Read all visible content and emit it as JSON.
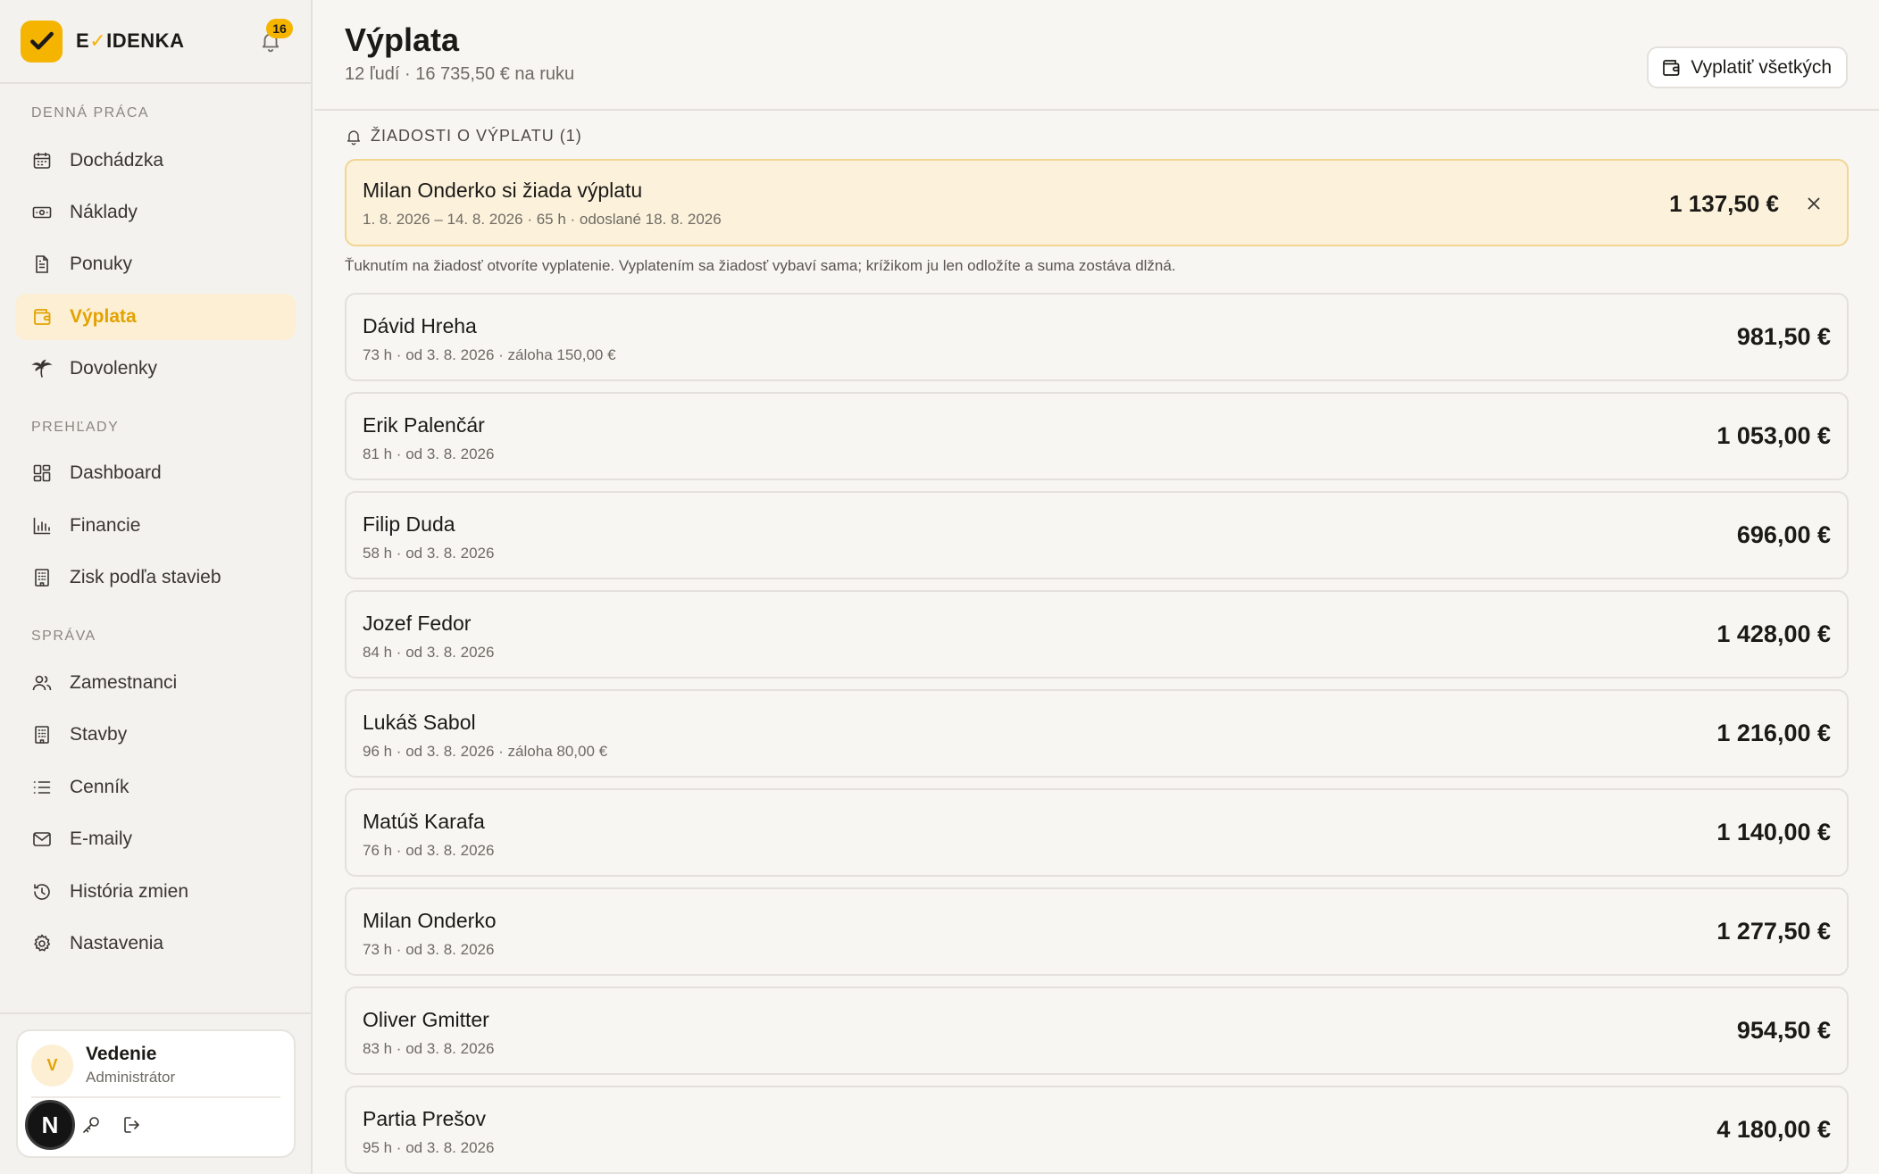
{
  "brand": {
    "name_prefix": "E",
    "name_mark": "✓",
    "name_suffix": "IDENKA",
    "notification_count": "16"
  },
  "sidebar": {
    "sections": [
      {
        "title": "DENNÁ PRÁCA",
        "items": [
          {
            "label": "Dochádzka",
            "icon": "calendar-icon"
          },
          {
            "label": "Náklady",
            "icon": "cash-icon"
          },
          {
            "label": "Ponuky",
            "icon": "document-icon"
          },
          {
            "label": "Výplata",
            "icon": "wallet-icon",
            "active": true
          },
          {
            "label": "Dovolenky",
            "icon": "palm-tree-icon"
          }
        ]
      },
      {
        "title": "PREHĽADY",
        "items": [
          {
            "label": "Dashboard",
            "icon": "dashboard-icon"
          },
          {
            "label": "Financie",
            "icon": "bar-chart-icon"
          },
          {
            "label": "Zisk podľa stavieb",
            "icon": "building-icon"
          }
        ]
      },
      {
        "title": "SPRÁVA",
        "items": [
          {
            "label": "Zamestnanci",
            "icon": "users-icon"
          },
          {
            "label": "Stavby",
            "icon": "building-icon"
          },
          {
            "label": "Cenník",
            "icon": "list-icon"
          },
          {
            "label": "E-maily",
            "icon": "mail-icon"
          },
          {
            "label": "História zmien",
            "icon": "history-icon"
          },
          {
            "label": "Nastavenia",
            "icon": "gear-icon"
          }
        ]
      }
    ],
    "user": {
      "initial": "V",
      "name": "Vedenie",
      "role": "Administrátor",
      "badge": "N"
    }
  },
  "header": {
    "title": "Výplata",
    "subtitle": "12 ľudí · 16 735,50 € na ruku",
    "pay_all_label": "Vyplatiť všetkých"
  },
  "requests": {
    "title": "ŽIADOSTI O VÝPLATU (1)",
    "items": [
      {
        "title": "Milan Onderko si žiada výplatu",
        "meta": "1. 8. 2026 – 14. 8. 2026 · 65 h · odoslané 18. 8. 2026",
        "amount": "1 137,50 €"
      }
    ],
    "hint": "Ťuknutím na žiadosť otvoríte vyplatenie. Vyplatením sa žiadosť vybaví sama; krížikom ju len odložíte a suma zostáva dlžná."
  },
  "employees": [
    {
      "name": "Dávid Hreha",
      "meta": "73 h · od 3. 8. 2026 · záloha 150,00 €",
      "amount": "981,50 €"
    },
    {
      "name": "Erik Palenčár",
      "meta": "81 h · od 3. 8. 2026",
      "amount": "1 053,00 €"
    },
    {
      "name": "Filip Duda",
      "meta": "58 h · od 3. 8. 2026",
      "amount": "696,00 €"
    },
    {
      "name": "Jozef Fedor",
      "meta": "84 h · od 3. 8. 2026",
      "amount": "1 428,00 €"
    },
    {
      "name": "Lukáš Sabol",
      "meta": "96 h · od 3. 8. 2026 · záloha 80,00 €",
      "amount": "1 216,00 €"
    },
    {
      "name": "Matúš Karafa",
      "meta": "76 h · od 3. 8. 2026",
      "amount": "1 140,00 €"
    },
    {
      "name": "Milan Onderko",
      "meta": "73 h · od 3. 8. 2026",
      "amount": "1 277,50 €"
    },
    {
      "name": "Oliver Gmitter",
      "meta": "83 h · od 3. 8. 2026",
      "amount": "954,50 €"
    },
    {
      "name": "Partia Prešov",
      "meta": "95 h · od 3. 8. 2026",
      "amount": "4 180,00 €"
    }
  ],
  "colors": {
    "accent": "#f5b400",
    "active_bg": "#fcefd4",
    "request_bg": "#fcf2dc"
  }
}
